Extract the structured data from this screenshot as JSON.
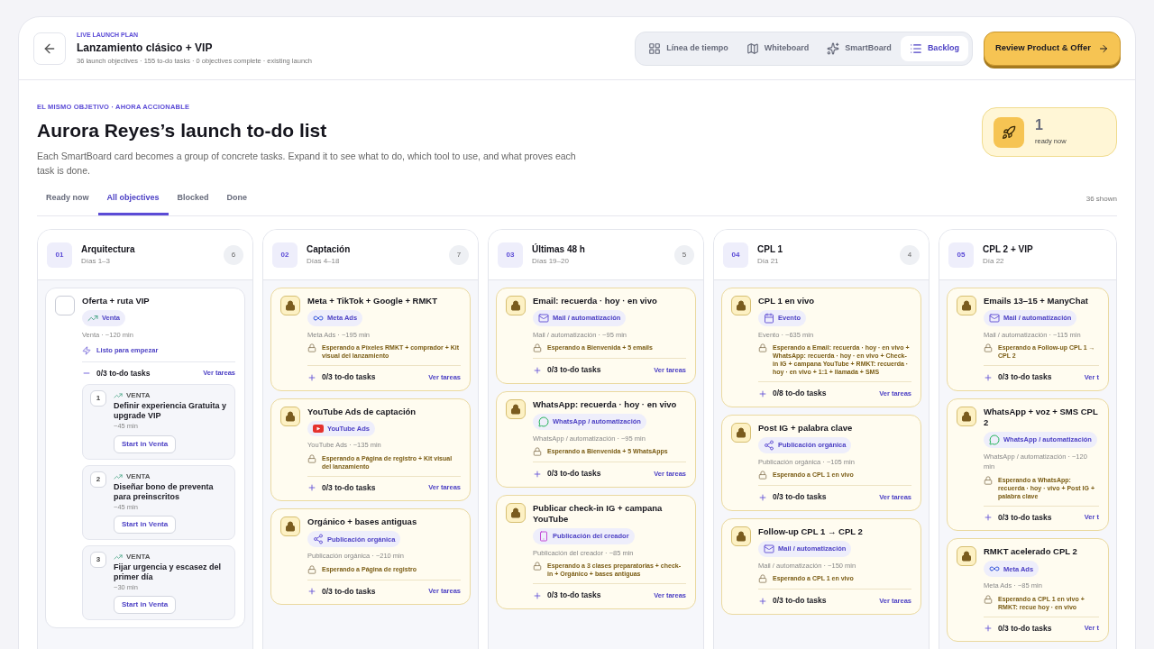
{
  "header": {
    "kicker": "LIVE LAUNCH PLAN",
    "title": "Lanzamiento clásico + VIP",
    "subtitle": "36 launch objectives · 155 to-do tasks · 0 objectives complete · existing launch"
  },
  "view_tabs": [
    {
      "label": "Línea de tiempo",
      "selected": false
    },
    {
      "label": "Whiteboard",
      "selected": false
    },
    {
      "label": "SmartBoard",
      "selected": false
    },
    {
      "label": "Backlog",
      "selected": true
    }
  ],
  "cta": "Review Product & Offer",
  "section": {
    "kicker": "EL MISMO OBJETIVO · AHORA ACCIONABLE",
    "title": "Aurora Reyes’s launch to-do list",
    "description": "Each SmartBoard card becomes a group of concrete tasks. Expand it to see what to do, which tool to use, and what proves each task is done."
  },
  "stat": {
    "value": "1",
    "label": "ready now"
  },
  "filter_tabs": [
    {
      "label": "Ready now",
      "selected": false
    },
    {
      "label": "All objectives",
      "selected": true
    },
    {
      "label": "Blocked",
      "selected": false
    },
    {
      "label": "Done",
      "selected": false
    }
  ],
  "shown": "36 shown",
  "columns": [
    {
      "number": "01",
      "title": "Arquitectura",
      "days": "Días 1–3",
      "count": "6",
      "cards": [
        {
          "title": "Oferta + ruta VIP",
          "tool": {
            "kind": "trend",
            "label": "Venta"
          },
          "meta": "Venta · ~120 min",
          "locked": false,
          "status": "Listo para empezar",
          "tasks": "0/3 to-do tasks",
          "link": "Ver tareas",
          "expanded": true,
          "subtasks": [
            {
              "number": "1",
              "category": "VENTA",
              "title": "Definir experiencia Gratuita y upgrade VIP",
              "time": "~45 min",
              "action": "Start in Venta"
            },
            {
              "number": "2",
              "category": "VENTA",
              "title": "Diseñar bono de preventa para preinscritos",
              "time": "~45 min",
              "action": "Start in Venta"
            },
            {
              "number": "3",
              "category": "VENTA",
              "title": "Fijar urgencia y escasez del primer día",
              "time": "~30 min",
              "action": "Start in Venta"
            }
          ]
        }
      ]
    },
    {
      "number": "02",
      "title": "Captación",
      "days": "Días 4–18",
      "count": "7",
      "cards": [
        {
          "title": "Meta + TikTok + Google + RMKT",
          "tool": {
            "kind": "meta",
            "label": "Meta Ads"
          },
          "meta": "Meta Ads · ~195 min",
          "locked": true,
          "blocked": "Esperando a Píxeles RMKT + comprador + Kit visual del lanzamiento",
          "tasks": "0/3 to-do tasks",
          "link": "Ver tareas",
          "expanded": false
        },
        {
          "title": "YouTube Ads de captación",
          "tool": {
            "kind": "youtube",
            "label": "YouTube Ads"
          },
          "meta": "YouTube Ads · ~135 min",
          "locked": true,
          "blocked": "Esperando a Página de registro + Kit visual del lanzamiento",
          "tasks": "0/3 to-do tasks",
          "link": "Ver tareas",
          "expanded": false
        },
        {
          "title": "Orgánico + bases antiguas",
          "tool": {
            "kind": "share",
            "label": "Publicación orgánica"
          },
          "meta": "Publicación orgánica · ~210 min",
          "locked": true,
          "blocked": "Esperando a Página de registro",
          "tasks": "0/3 to-do tasks",
          "link": "Ver tareas",
          "expanded": false
        }
      ]
    },
    {
      "number": "03",
      "title": "Últimas 48 h",
      "days": "Días 19–20",
      "count": "5",
      "cards": [
        {
          "title": "Email: recuerda · hoy · en vivo",
          "tool": {
            "kind": "mail",
            "label": "Mail / automatización"
          },
          "meta": "Mail / automatización · ~95 min",
          "locked": true,
          "blocked": "Esperando a Bienvenida + 5 emails",
          "tasks": "0/3 to-do tasks",
          "link": "Ver tareas",
          "expanded": false
        },
        {
          "title": "WhatsApp: recuerda · hoy · en vivo",
          "tool": {
            "kind": "whatsapp",
            "label": "WhatsApp / automatización"
          },
          "meta": "WhatsApp / automatización · ~95 min",
          "locked": true,
          "blocked": "Esperando a Bienvenida + 5 WhatsApps",
          "tasks": "0/3 to-do tasks",
          "link": "Ver tareas",
          "expanded": false
        },
        {
          "title": "Publicar check-in IG + campana YouTube",
          "tool": {
            "kind": "phone",
            "label": "Publicación del creador"
          },
          "meta": "Publicación del creador · ~85 min",
          "locked": true,
          "blocked": "Esperando a 3 clases preparatorias + check-in + Orgánico + bases antiguas",
          "tasks": "0/3 to-do tasks",
          "link": "Ver tareas",
          "expanded": false
        }
      ]
    },
    {
      "number": "04",
      "title": "CPL 1",
      "days": "Día 21",
      "count": "4",
      "cards": [
        {
          "title": "CPL 1 en vivo",
          "tool": {
            "kind": "calendar",
            "label": "Evento"
          },
          "meta": "Evento · ~635 min",
          "locked": true,
          "blocked": "Esperando a Email: recuerda · hoy · en vivo + WhatsApp: recuerda · hoy · en vivo + Check-in IG + campana YouTube + RMKT: recuerda · hoy · en vivo + 1:1 + llamada + SMS",
          "tasks": "0/8 to-do tasks",
          "link": "Ver tareas",
          "expanded": false
        },
        {
          "title": "Post IG + palabra clave",
          "tool": {
            "kind": "share",
            "label": "Publicación orgánica"
          },
          "meta": "Publicación orgánica · ~105 min",
          "locked": true,
          "blocked": "Esperando a CPL 1 en vivo",
          "tasks": "0/3 to-do tasks",
          "link": "Ver tareas",
          "expanded": false
        },
        {
          "title": "Follow-up CPL 1 → CPL 2",
          "tool": {
            "kind": "mail",
            "label": "Mail / automatización"
          },
          "meta": "Mail / automatización · ~150 min",
          "locked": true,
          "blocked": "Esperando a CPL 1 en vivo",
          "tasks": "0/3 to-do tasks",
          "link": "Ver tareas",
          "expanded": false
        }
      ]
    },
    {
      "number": "05",
      "title": "CPL 2 + VIP",
      "days": "Día 22",
      "cards": [
        {
          "title": "Emails 13–15 + ManyChat",
          "tool": {
            "kind": "mail",
            "label": "Mail / automatización"
          },
          "meta": "Mail / automatización · ~115 min",
          "locked": true,
          "blocked": "Esperando a Follow-up CPL 1 → CPL 2",
          "tasks": "0/3 to-do tasks",
          "link": "Ver t",
          "expanded": false
        },
        {
          "title": "WhatsApp + voz + SMS CPL 2",
          "tool": {
            "kind": "whatsapp",
            "label": "WhatsApp / automatización"
          },
          "meta": "WhatsApp / automatización · ~120 min",
          "locked": true,
          "blocked": "Esperando a WhatsApp: recuerda · hoy · vivo + Post IG + palabra clave",
          "tasks": "0/3 to-do tasks",
          "link": "Ver t",
          "expanded": false
        },
        {
          "title": "RMKT acelerado CPL 2",
          "tool": {
            "kind": "meta",
            "label": "Meta Ads"
          },
          "meta": "Meta Ads · ~85 min",
          "locked": true,
          "blocked": "Esperando a CPL 1 en vivo + RMKT: recue hoy · en vivo",
          "tasks": "0/3 to-do tasks",
          "link": "Ver t",
          "expanded": false
        }
      ]
    }
  ]
}
